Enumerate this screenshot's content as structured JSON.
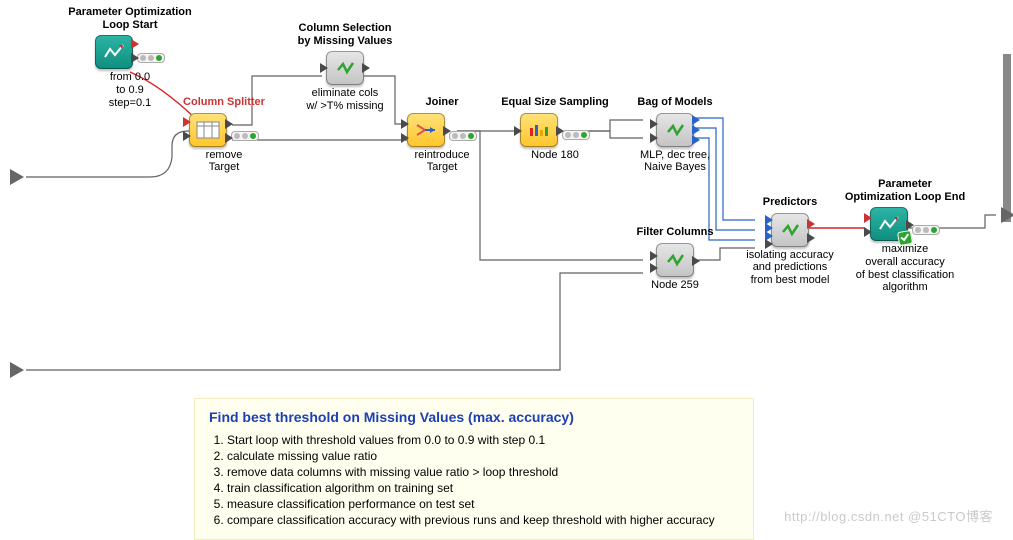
{
  "nodes": {
    "loop_start": {
      "title": "Parameter Optimization\nLoop Start",
      "caption": "from 0.0\nto 0.9\nstep=0.1",
      "status": "executed"
    },
    "column_splitter": {
      "title": "Column Splitter",
      "caption": "remove\nTarget",
      "status": "executed"
    },
    "col_sel_missing": {
      "title": "Column Selection\nby Missing Values",
      "caption": "eliminate cols\nw/ >T% missing",
      "status": "executed"
    },
    "joiner": {
      "title": "Joiner",
      "caption": "reintroduce\nTarget",
      "status": "executed"
    },
    "equal_size": {
      "title": "Equal Size Sampling",
      "caption": "Node 180",
      "status": "executed"
    },
    "bag_models": {
      "title": "Bag of Models",
      "caption": "MLP, dec tree,\nNaive Bayes",
      "status": "executed"
    },
    "filter_cols": {
      "title": "Filter Columns",
      "caption": "Node 259",
      "status": "executed"
    },
    "predictors": {
      "title": "Predictors",
      "caption": "isolating accuracy\nand predictions\nfrom best model",
      "status": "executed"
    },
    "loop_end": {
      "title": "Parameter\nOptimization Loop End",
      "caption": "maximize\noverall accuracy\nof best classification\nalgorithm",
      "status": "executed"
    }
  },
  "connections": [
    {
      "from": "loop_start",
      "to": "column_splitter",
      "type": "flowvar"
    },
    {
      "from": "workflow_in_1",
      "to": "column_splitter",
      "type": "data"
    },
    {
      "from": "column_splitter",
      "to": "col_sel_missing",
      "type": "data"
    },
    {
      "from": "column_splitter",
      "to": "joiner",
      "type": "data"
    },
    {
      "from": "col_sel_missing",
      "to": "joiner",
      "type": "data"
    },
    {
      "from": "joiner",
      "to": "equal_size",
      "type": "data"
    },
    {
      "from": "joiner",
      "to": "filter_cols",
      "type": "data"
    },
    {
      "from": "equal_size",
      "to": "bag_models",
      "type": "data"
    },
    {
      "from": "bag_models",
      "to": "predictors",
      "type": "model"
    },
    {
      "from": "filter_cols",
      "to": "predictors",
      "type": "data"
    },
    {
      "from": "workflow_in_2",
      "to": "filter_cols",
      "type": "data"
    },
    {
      "from": "predictors",
      "to": "loop_end",
      "type": "flowvar"
    },
    {
      "from": "loop_end",
      "to": "workflow_out",
      "type": "data"
    }
  ],
  "annotation": {
    "title": "Find  best threshold on Missing Values (max. accuracy)",
    "steps": [
      "Start loop with threshold values from 0.0 to 0.9 with step 0.1",
      "calculate missing value ratio",
      "remove data columns with missing value ratio > loop threshold",
      "train classification algorithm on training set",
      "measure classification performance on test set",
      "compare classification accuracy with previous runs and keep threshold with higher accuracy"
    ]
  },
  "watermark": "http://blog.csdn.net  @51CTO博客",
  "colors": {
    "flowvar": "#d22",
    "data": "#616161",
    "model": "#2a63c7",
    "metanode": "#c3c3c3",
    "manipulator": "#ffc52b",
    "loop": "#0e8e7e"
  }
}
